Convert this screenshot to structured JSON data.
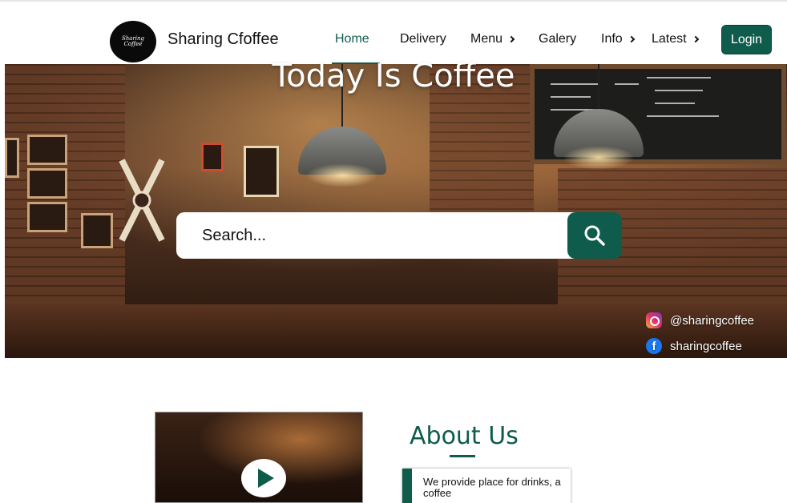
{
  "header": {
    "logo_text": "Sharing Coffee",
    "brand_name": "Sharing Cfoffee",
    "nav": [
      {
        "label": "Home",
        "active": true
      },
      {
        "label": "Delivery"
      },
      {
        "label": "Menu",
        "has_chevron": true
      },
      {
        "label": "Galery"
      },
      {
        "label": "Info",
        "has_chevron": true
      },
      {
        "label": "Latest",
        "has_chevron": true
      }
    ],
    "login_label": "Login"
  },
  "hero": {
    "title": "Today Is Coffee",
    "search_placeholder": "Search...",
    "search_icon": "search-icon"
  },
  "social": {
    "instagram": "@sharingcoffee",
    "facebook": "sharingcoffee"
  },
  "about": {
    "title": "About Us",
    "text": "We provide place for drinks, a coffee"
  },
  "colors": {
    "accent": "#0f5c4d",
    "text": "#111111",
    "background": "#ffffff"
  }
}
